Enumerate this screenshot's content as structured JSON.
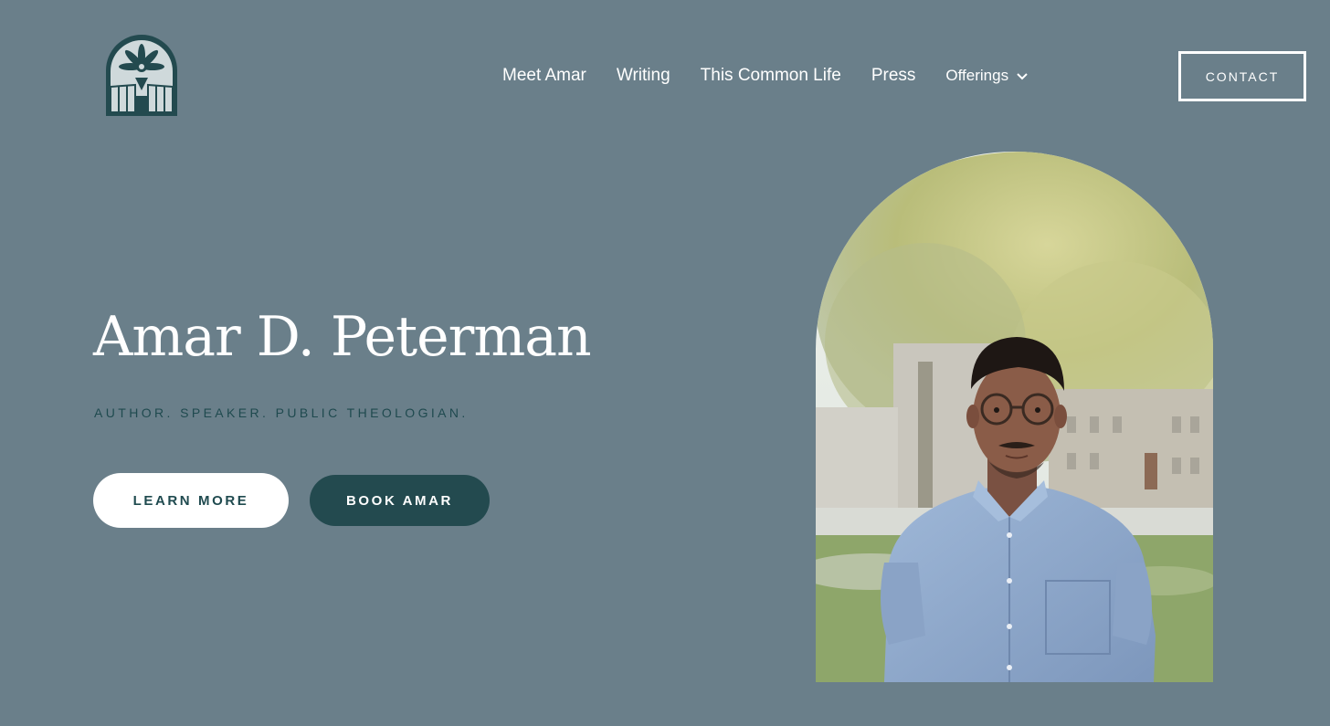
{
  "nav": {
    "items": [
      {
        "label": "Meet Amar"
      },
      {
        "label": "Writing"
      },
      {
        "label": "This Common Life"
      },
      {
        "label": "Press"
      }
    ],
    "offerings_label": "Offerings",
    "contact_label": "CONTACT"
  },
  "hero": {
    "title": "Amar D. Peterman",
    "tagline": "AUTHOR. SPEAKER. PUBLIC THEOLOGIAN.",
    "learn_more_label": "LEARN MORE",
    "book_label": "BOOK AMAR"
  },
  "icons": {
    "logo": "stained-glass-arch-pen-logo",
    "offerings_dropdown": "chevron-down-icon"
  },
  "colors": {
    "background": "#6a7f8a",
    "accent_dark": "#234a4f",
    "text_light": "#ffffff"
  }
}
